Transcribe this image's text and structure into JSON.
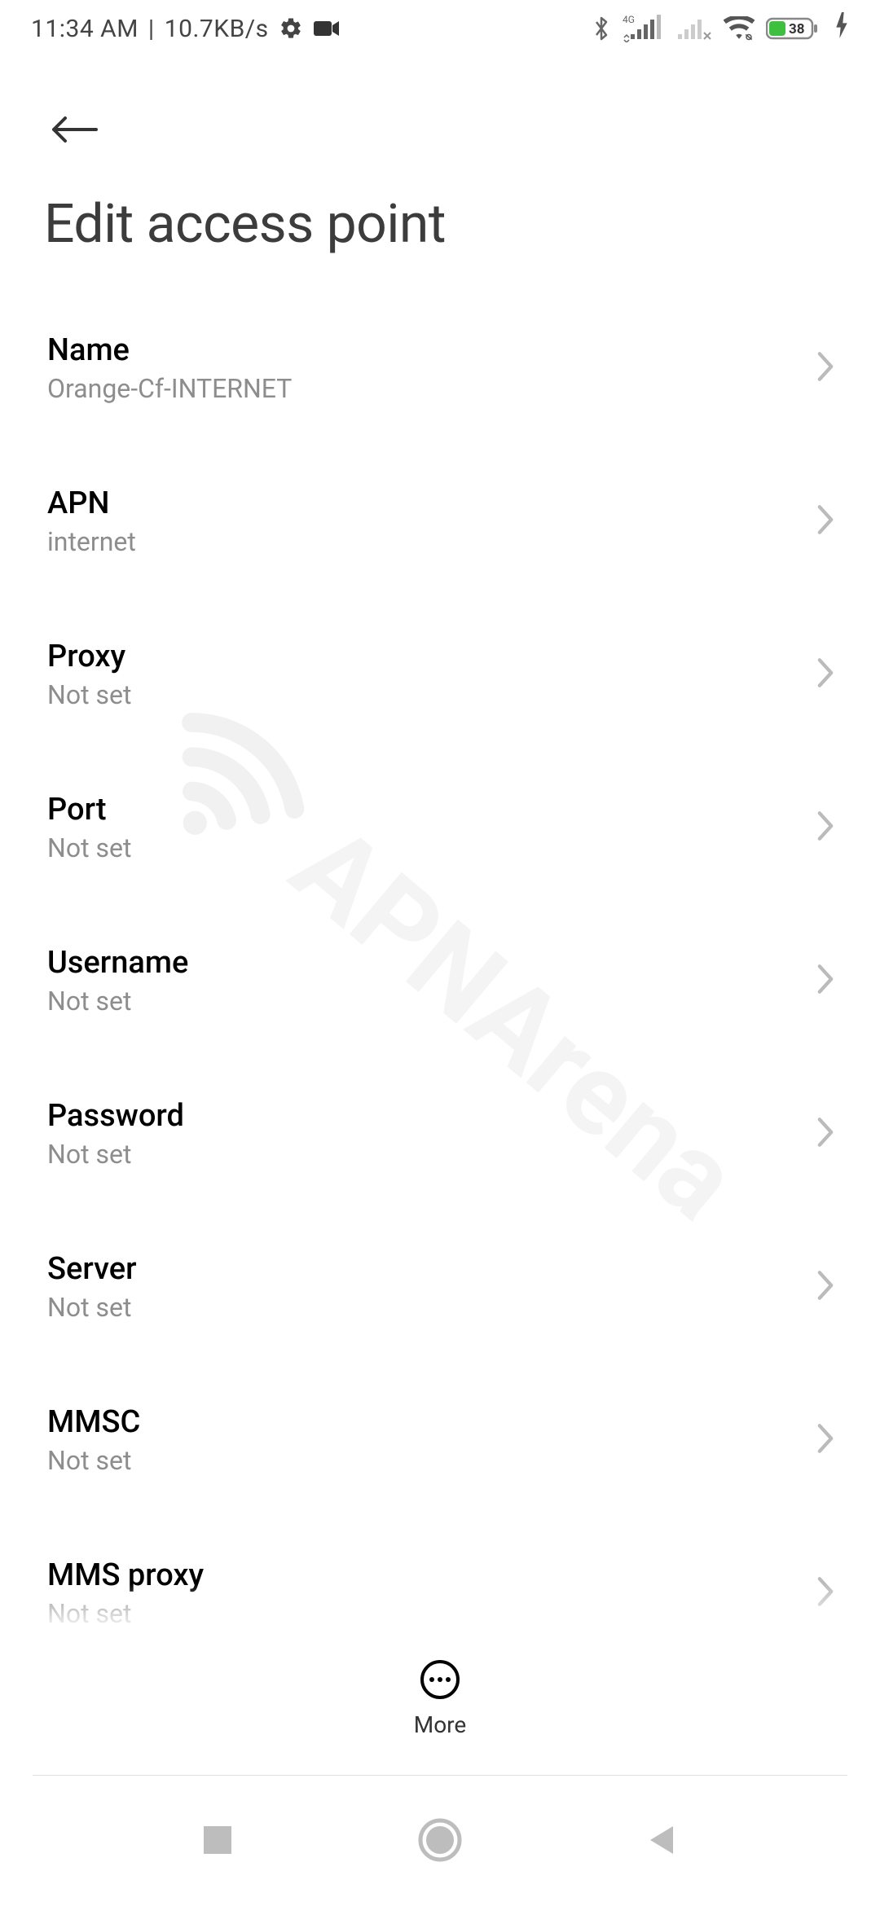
{
  "statusbar": {
    "time": "11:34 AM",
    "net_speed": "10.7KB/s",
    "battery_pct": "38",
    "indicators": {
      "network_type": "4G"
    }
  },
  "header": {
    "title": "Edit access point"
  },
  "rows": [
    {
      "key": "name",
      "label": "Name",
      "value": "Orange-Cf-INTERNET"
    },
    {
      "key": "apn",
      "label": "APN",
      "value": "internet"
    },
    {
      "key": "proxy",
      "label": "Proxy",
      "value": "Not set"
    },
    {
      "key": "port",
      "label": "Port",
      "value": "Not set"
    },
    {
      "key": "username",
      "label": "Username",
      "value": "Not set"
    },
    {
      "key": "password",
      "label": "Password",
      "value": "Not set"
    },
    {
      "key": "server",
      "label": "Server",
      "value": "Not set"
    },
    {
      "key": "mmsc",
      "label": "MMSC",
      "value": "Not set"
    },
    {
      "key": "mms_proxy",
      "label": "MMS proxy",
      "value": "Not set"
    }
  ],
  "bottom": {
    "more_label": "More"
  },
  "watermark": "APNArena"
}
